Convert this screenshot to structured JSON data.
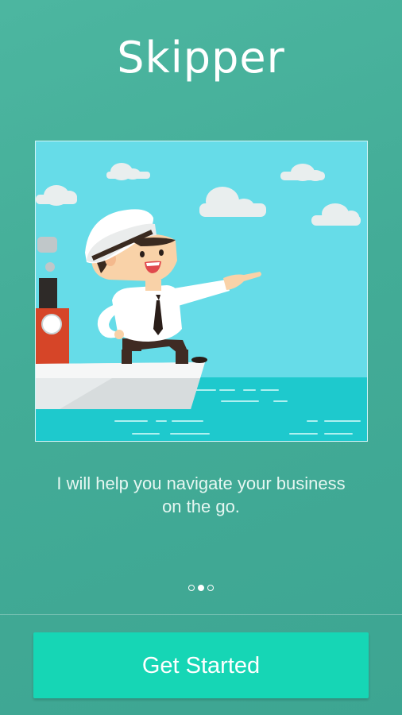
{
  "app": {
    "title": "Skipper"
  },
  "onboarding": {
    "illustration_icon": "captain-on-ship-illustration",
    "tagline": "I will help you navigate your business on the go.",
    "pager": {
      "total": 3,
      "active_index": 1
    }
  },
  "footer": {
    "button_label": "Get Started"
  },
  "colors": {
    "background": "#43ac97",
    "button": "#16d6b5",
    "sky": "#66dce8",
    "sea": "#1ec9cd",
    "chimney": "#d64528"
  }
}
